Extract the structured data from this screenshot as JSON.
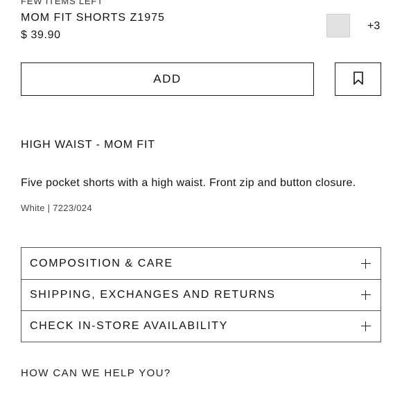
{
  "product": {
    "stock_note": "FEW ITEMS LEFT",
    "name": "MOM FIT SHORTS Z1975",
    "price": "$ 39.90",
    "swatch_color": "#e2e2e2",
    "more_colors": "+3",
    "fit": "HIGH WAIST - MOM FIT",
    "description": "Five pocket shorts with a high waist. Front zip and button closure.",
    "color_ref": "White | 7223/024"
  },
  "actions": {
    "add_label": "ADD",
    "save_icon": "bookmark-icon"
  },
  "accordion": {
    "items": [
      {
        "label": "COMPOSITION & CARE",
        "icon": "plus-icon"
      },
      {
        "label": "SHIPPING, EXCHANGES AND RETURNS",
        "icon": "plus-icon"
      },
      {
        "label": "CHECK IN-STORE AVAILABILITY",
        "icon": "plus-icon"
      }
    ]
  },
  "help": {
    "label": "HOW CAN WE HELP YOU?"
  }
}
